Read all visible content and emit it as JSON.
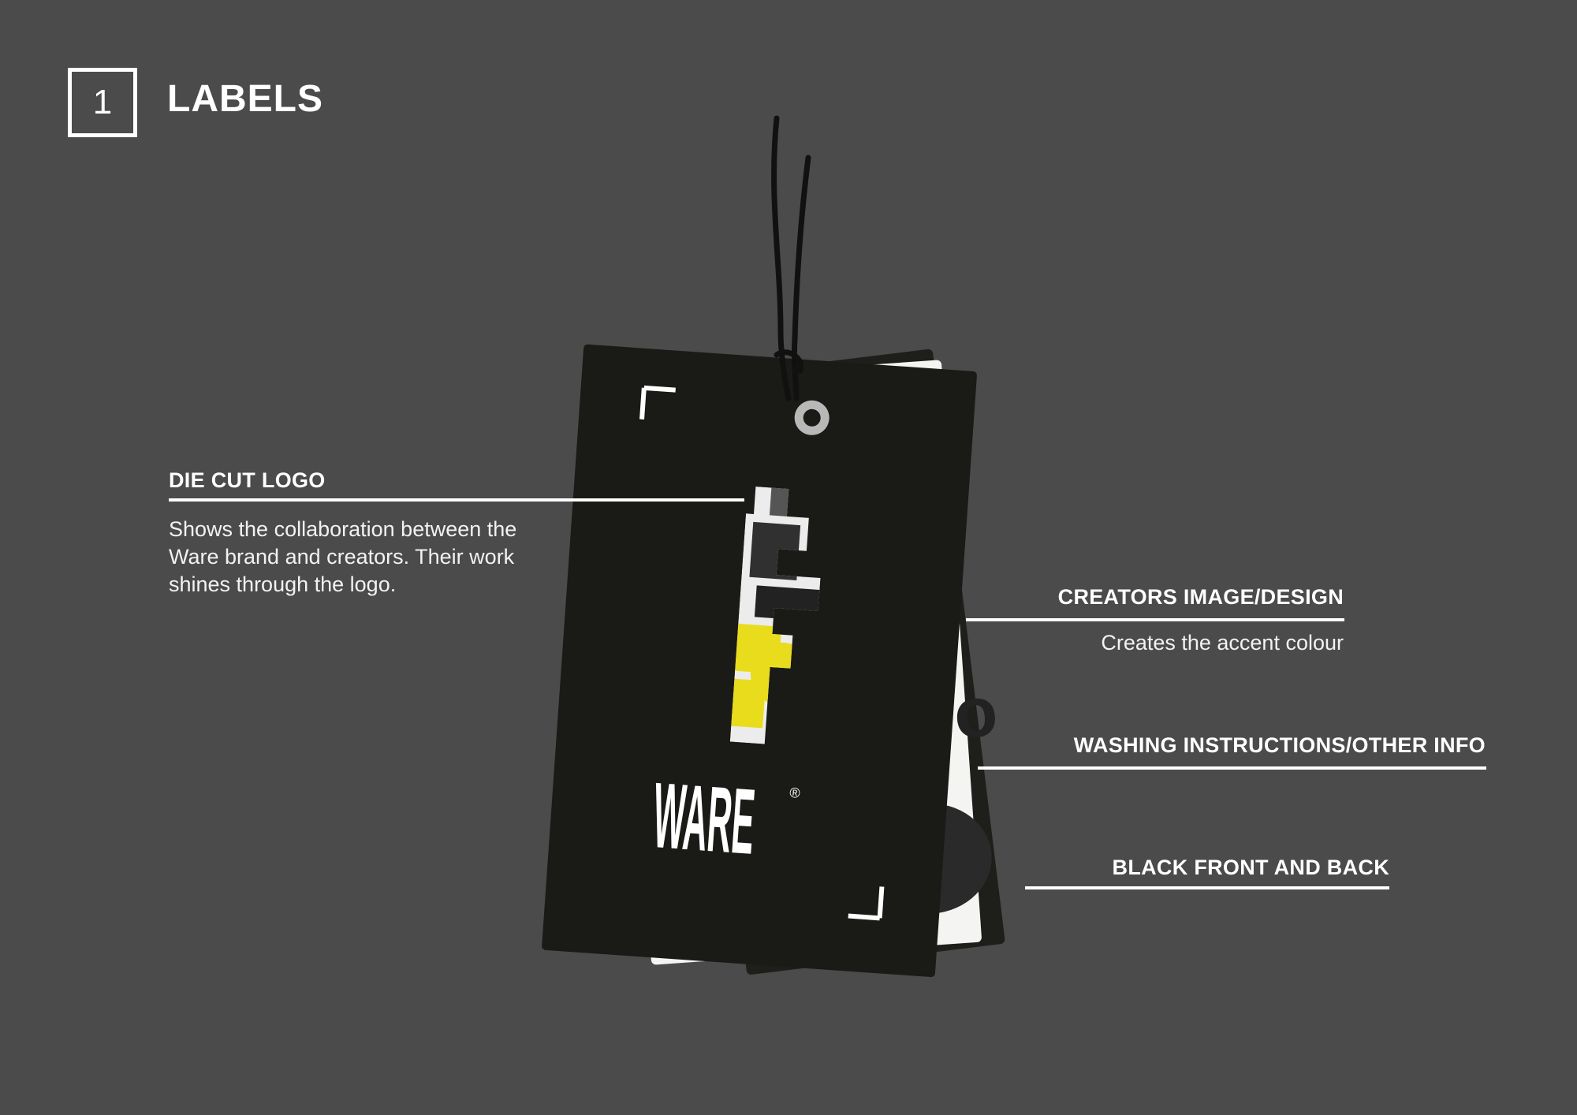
{
  "header": {
    "section_number": "1",
    "section_title": "LABELS"
  },
  "annotations": {
    "die_cut": {
      "heading": "DIE CUT LOGO",
      "body_lines": [
        "Shows the collaboration between the",
        "Ware brand and creators. Their work",
        "shines through the logo."
      ]
    },
    "creators": {
      "heading": "CREATORS IMAGE/DESIGN",
      "body": "Creates the accent colour"
    },
    "washing": {
      "heading": "WASHING INSTRUCTIONS/OTHER INFO"
    },
    "black": {
      "heading": "BLACK FRONT AND BACK"
    }
  },
  "hangtag": {
    "brand_text": "WARE",
    "brand_mark": "®",
    "collage_text": "Mo"
  },
  "colors": {
    "background": "#4b4b4b",
    "tag_black": "#1a1a16",
    "accent_yellow": "#e8dc1c",
    "white": "#ffffff"
  }
}
